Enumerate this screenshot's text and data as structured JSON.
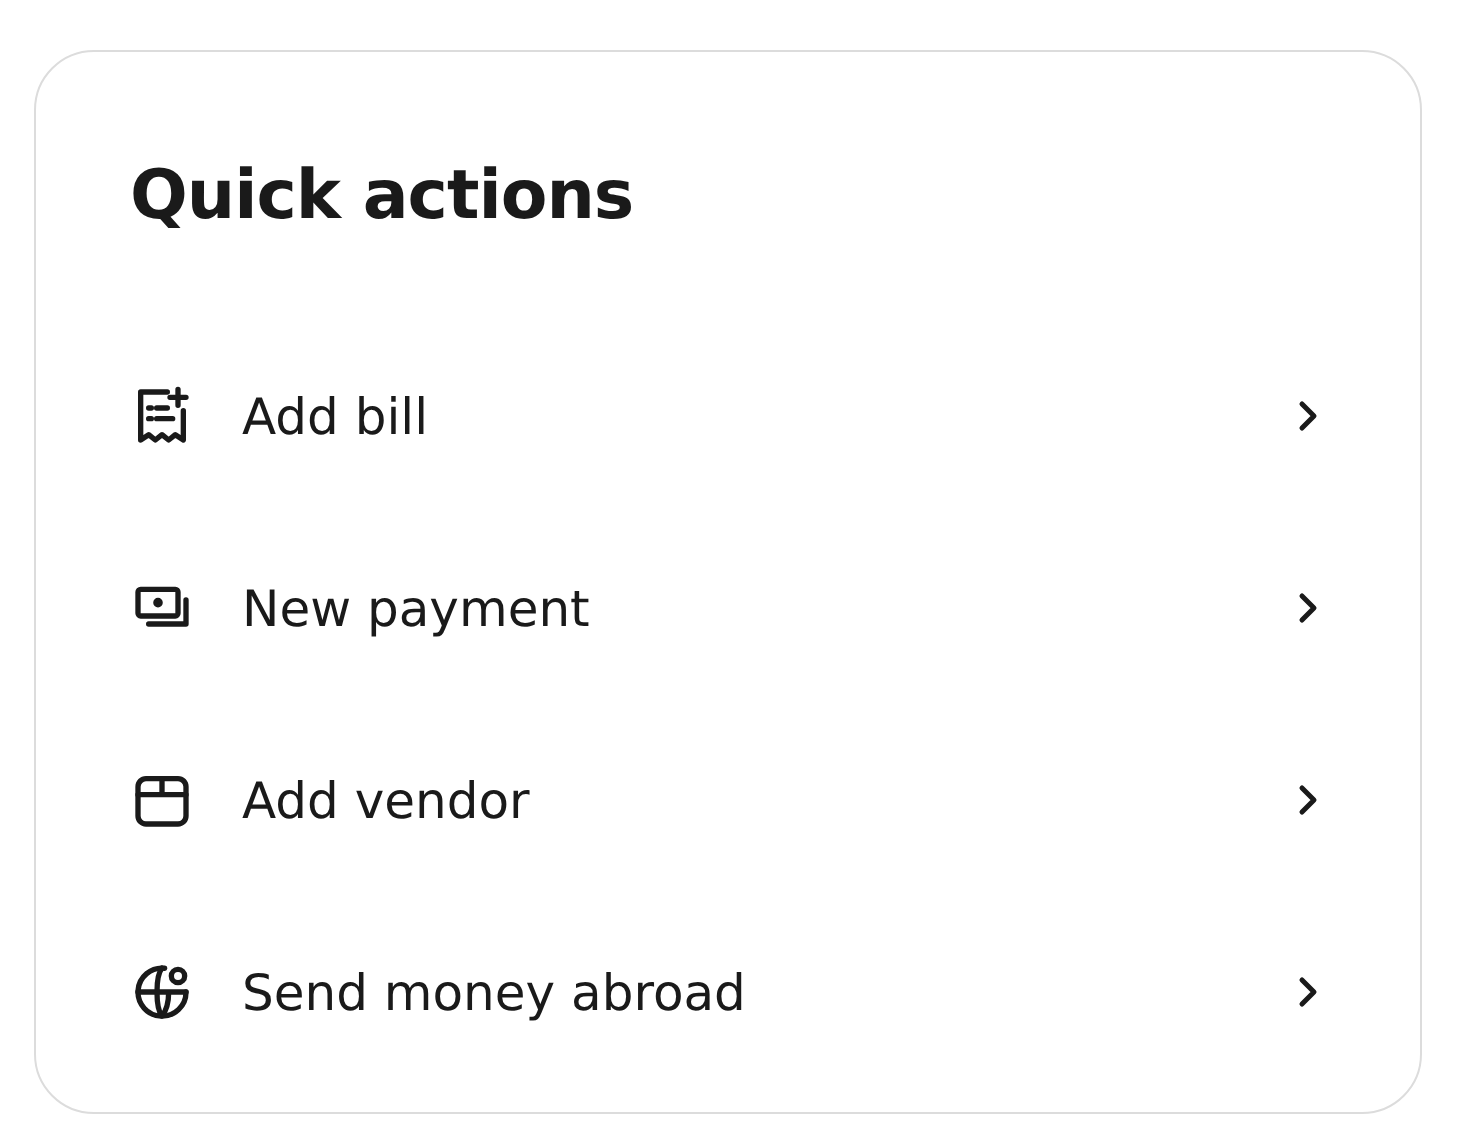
{
  "title": "Quick actions",
  "actions": [
    {
      "kind": "bill",
      "label": "Add bill"
    },
    {
      "kind": "payment",
      "label": "New payment"
    },
    {
      "kind": "vendor",
      "label": "Add vendor"
    },
    {
      "kind": "abroad",
      "label": "Send money abroad"
    }
  ]
}
